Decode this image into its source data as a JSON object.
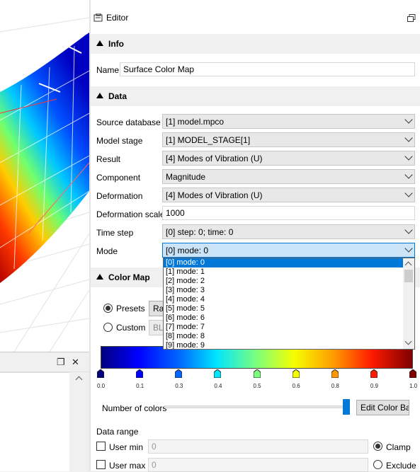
{
  "editor": {
    "title": "Editor",
    "info": {
      "section_label": "Info",
      "name_label": "Name",
      "name_value": "Surface Color Map"
    },
    "data": {
      "section_label": "Data",
      "source_database_label": "Source database",
      "source_database_value": "[1] model.mpco",
      "model_stage_label": "Model stage",
      "model_stage_value": "[1] MODEL_STAGE[1]",
      "result_label": "Result",
      "result_value": "[4] Modes of Vibration (U)",
      "component_label": "Component",
      "component_value": "Magnitude",
      "deformation_label": "Deformation",
      "deformation_value": "[4] Modes of Vibration (U)",
      "deformation_scale_label": "Deformation scale",
      "deformation_scale_value": "1000",
      "time_step_label": "Time step",
      "time_step_value": "[0] step: 0; time: 0",
      "mode_label": "Mode",
      "mode_value": "[0] mode: 0",
      "mode_options": [
        "[0] mode: 0",
        "[1] mode: 1",
        "[2] mode: 2",
        "[3] mode: 3",
        "[4] mode: 4",
        "[5] mode: 5",
        "[6] mode: 6",
        "[7] mode: 7",
        "[8] mode: 8",
        "[9] mode: 9"
      ]
    },
    "color_map": {
      "section_label": "Color Map",
      "presets_label": "Presets",
      "presets_value": "Rai",
      "custom_label": "Custom",
      "custom_value": "BLA",
      "ticks": [
        "0.0",
        "0.1",
        "0.3",
        "0.4",
        "0.5",
        "0.6",
        "0.8",
        "0.9",
        "1.0"
      ],
      "stop_colors": [
        "#00007f",
        "#0000ff",
        "#0066ff",
        "#00e5ff",
        "#7dff7d",
        "#f5ff00",
        "#ff9900",
        "#ff1a00",
        "#800000"
      ],
      "number_of_colors_label": "Number of colors",
      "number_of_colors_level": 1.0,
      "edit_color_bar_label": "Edit Color Bar",
      "data_range_label": "Data range",
      "user_min_label": "User min",
      "user_min_value": "0",
      "user_max_label": "User max",
      "user_max_value": "0",
      "clamp_label": "Clamp",
      "exclude_label": "Exclude"
    }
  }
}
